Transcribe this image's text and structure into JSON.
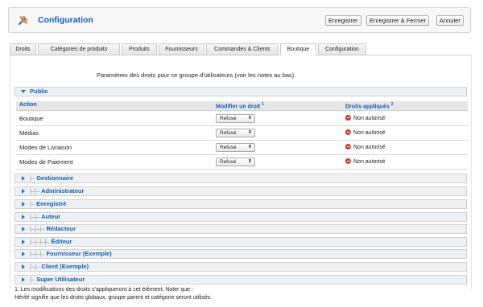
{
  "header": {
    "title": "Configuration",
    "buttons": {
      "save": "Enregistrer",
      "save_close": "Enregistrer & Fermer",
      "cancel": "Annuler"
    }
  },
  "tabs": [
    "Droits",
    "Catégories de produits",
    "Produits",
    "Fournisseurs",
    "Commandes & Clients",
    "Boutique",
    "Configuration"
  ],
  "active_tab": "Boutique",
  "intro": "Paramètres des droits pour ce groupe d'utilisateurs (voir les notes au bas).",
  "public_section": {
    "label": "Public",
    "columns": {
      "action": "Action",
      "modify": "Modifier un droit",
      "modify_sup": "1",
      "applied": "Droits appliqués",
      "applied_sup": "2"
    },
    "rows": [
      {
        "action": "Boutique",
        "select": "Refusé",
        "status": "Non autorisé"
      },
      {
        "action": "Médias",
        "select": "Refusé",
        "status": "Non autorisé"
      },
      {
        "action": "Modes de Livraison",
        "select": "Refusé",
        "status": "Non autorisé"
      },
      {
        "action": "Modes de Paiement",
        "select": "Refusé",
        "status": "Non autorisé"
      }
    ]
  },
  "groups": [
    {
      "prefix": "|–",
      "label": "Gestionnaire"
    },
    {
      "prefix": "|–|–",
      "label": "Administrateur"
    },
    {
      "prefix": "|–",
      "label": "Enregistré"
    },
    {
      "prefix": "|–|–",
      "label": "Auteur"
    },
    {
      "prefix": "|–|–|–",
      "label": "Rédacteur"
    },
    {
      "prefix": "|–|–|–|–",
      "label": "Éditeur"
    },
    {
      "prefix": "|–|–|–",
      "label": "Fournisseur (Exemple)"
    },
    {
      "prefix": "|–|–",
      "label": "Client (Exemple)"
    },
    {
      "prefix": "|–",
      "label": "Super Utilisateur"
    }
  ],
  "notes": {
    "note1": "1. Les modifications des droits s'appliqueront à cet élément. Noter que :",
    "note2_italic": "Hérité",
    "note2_rest": " signifie que les droits globaux, groupe parent et catégorie seront utilisés."
  },
  "colors": {
    "link_blue": "#135cae",
    "deny_red": "#d9362b"
  }
}
